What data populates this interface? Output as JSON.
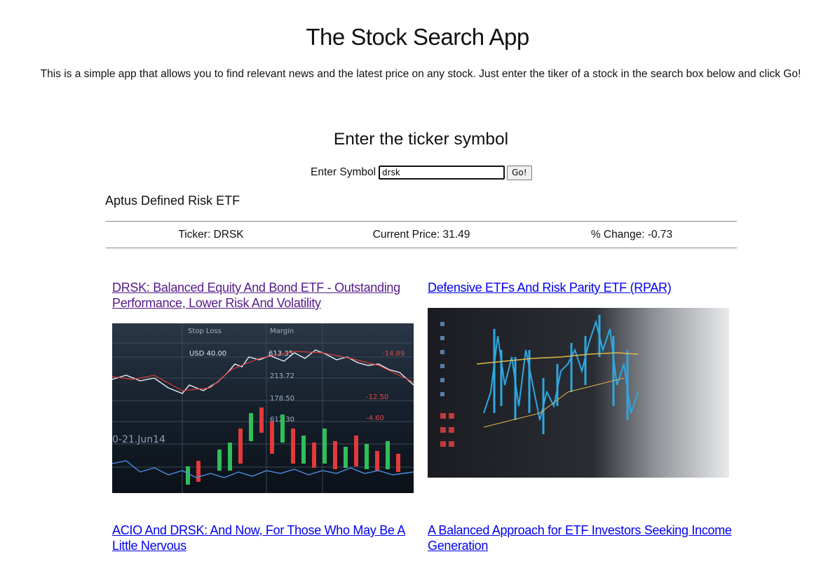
{
  "header": {
    "title": "The Stock Search App",
    "description": "This is a simple app that allows you to find relevant news and the latest price on any stock. Just enter the tiker of a stock in the search box below and click Go!"
  },
  "search": {
    "heading": "Enter the ticker symbol",
    "label": "Enter Symbol",
    "value": "drsk",
    "button_label": "Go!"
  },
  "quote": {
    "company_name": "Aptus Defined Risk ETF",
    "ticker_text": "Ticker: DRSK",
    "price_text": "Current Price: 31.49",
    "change_text": "% Change: -0.73"
  },
  "news": [
    {
      "title": "DRSK: Balanced Equity And Bond ETF - Outstanding Performance, Lower Risk And Volatility",
      "visited": true,
      "image": "candlestick-trading-screen-image",
      "image_labels": [
        "Stop Loss",
        "Margin",
        "USD 40.00",
        "613.35",
        "213.72",
        "178.50",
        "612.30",
        "0-21.Jun14",
        "-14.89",
        "-12.50",
        "-4.60"
      ]
    },
    {
      "title": "Defensive ETFs And Risk Parity ETF (RPAR)",
      "visited": false,
      "image": "stock-chart-monitor-image"
    },
    {
      "title": "ACIO And DRSK: And Now, For Those Who May Be A Little Nervous",
      "visited": false
    },
    {
      "title": "A Balanced Approach for ETF Investors Seeking Income Generation",
      "visited": false
    }
  ],
  "colors": {
    "link": "#0000ee",
    "visited_link": "#551a8b",
    "divider": "#888888"
  }
}
